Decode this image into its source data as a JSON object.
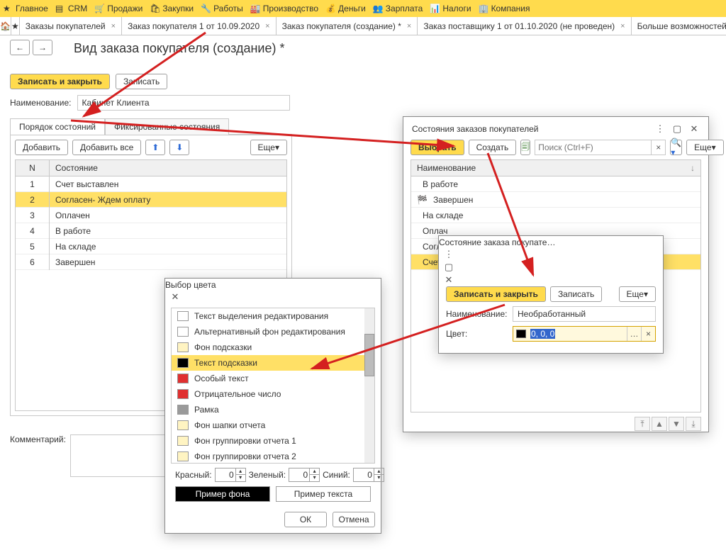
{
  "topnav": [
    {
      "label": "Главное"
    },
    {
      "label": "CRM"
    },
    {
      "label": "Продажи"
    },
    {
      "label": "Закупки"
    },
    {
      "label": "Работы"
    },
    {
      "label": "Производство"
    },
    {
      "label": "Деньги"
    },
    {
      "label": "Зарплата"
    },
    {
      "label": "Налоги"
    },
    {
      "label": "Компания"
    }
  ],
  "tabs": [
    {
      "label": "Заказы покупателей",
      "closable": true,
      "star": true
    },
    {
      "label": "Заказ покупателя 1 от 10.09.2020",
      "closable": true
    },
    {
      "label": "Заказ покупателя (создание) *",
      "closable": true,
      "active": true
    },
    {
      "label": "Заказ поставщику 1 от 01.10.2020 (не проведен)",
      "closable": true
    },
    {
      "label": "Больше возможностей: настройка пр",
      "closable": false
    }
  ],
  "page": {
    "title": "Вид заказа покупателя (создание) *",
    "save_close": "Записать и закрыть",
    "save": "Записать",
    "name_label": "Наименование:",
    "name_value": "Кабинет Клиента",
    "states_tab": "Порядок состояний",
    "fixed_tab": "Фиксированные состояния",
    "add": "Добавить",
    "add_all": "Добавить все",
    "more": "Еще",
    "col_n": "N",
    "col_state": "Состояние",
    "rows": [
      {
        "n": "1",
        "state": "Счет выставлен"
      },
      {
        "n": "2",
        "state": "Согласен- Ждем оплату",
        "selected": true
      },
      {
        "n": "3",
        "state": "Оплачен"
      },
      {
        "n": "4",
        "state": "В работе"
      },
      {
        "n": "5",
        "state": "На складе"
      },
      {
        "n": "6",
        "state": "Завершен"
      }
    ],
    "comment_label": "Комментарий:"
  },
  "right": {
    "title": "Состояния заказов покупателей",
    "select": "Выбрать",
    "create": "Создать",
    "search_ph": "Поиск (Ctrl+F)",
    "more": "Еще",
    "col": "Наименование",
    "rows": [
      {
        "label": "В работе",
        "color": "#2e86de"
      },
      {
        "label": "Завершен",
        "color": "#e0b000",
        "flag": true
      },
      {
        "label": "На складе",
        "color": "#2e86de"
      },
      {
        "label": "Оплач",
        "color": "#2e86de"
      },
      {
        "label": "Согла",
        "color": "#2e86de"
      },
      {
        "label": "Счет в",
        "color": "#2e86de",
        "selected": true
      }
    ]
  },
  "inner": {
    "title": "Состояние заказа покупате…",
    "save_close": "Записать и закрыть",
    "save": "Записать",
    "more": "Еще",
    "name_label": "Наименование:",
    "name_value": "Необработанный",
    "color_label": "Цвет:",
    "color_value": "0, 0, 0"
  },
  "color": {
    "title": "Выбор цвета",
    "items": [
      {
        "label": "Текст выделения редактирования",
        "c": "#ffffff"
      },
      {
        "label": "Альтернативный фон редактирования",
        "c": "#ffffff"
      },
      {
        "label": "Фон подсказки",
        "c": "#fff4c2"
      },
      {
        "label": "Текст подсказки",
        "c": "#000000",
        "selected": true
      },
      {
        "label": "Особый текст",
        "c": "#e03030"
      },
      {
        "label": "Отрицательное число",
        "c": "#e03030"
      },
      {
        "label": "Рамка",
        "c": "#9a9a9a"
      },
      {
        "label": "Фон шапки отчета",
        "c": "#fff4c2"
      },
      {
        "label": "Фон группировки отчета 1",
        "c": "#fff4c2"
      },
      {
        "label": "Фон группировки отчета 2",
        "c": "#fff4c2"
      }
    ],
    "r_label": "Красный:",
    "r": "0",
    "g_label": "Зеленый:",
    "g": "0",
    "b_label": "Синий:",
    "b": "0",
    "bg_preview": "Пример фона",
    "txt_preview": "Пример текста",
    "ok": "ОК",
    "cancel": "Отмена"
  }
}
